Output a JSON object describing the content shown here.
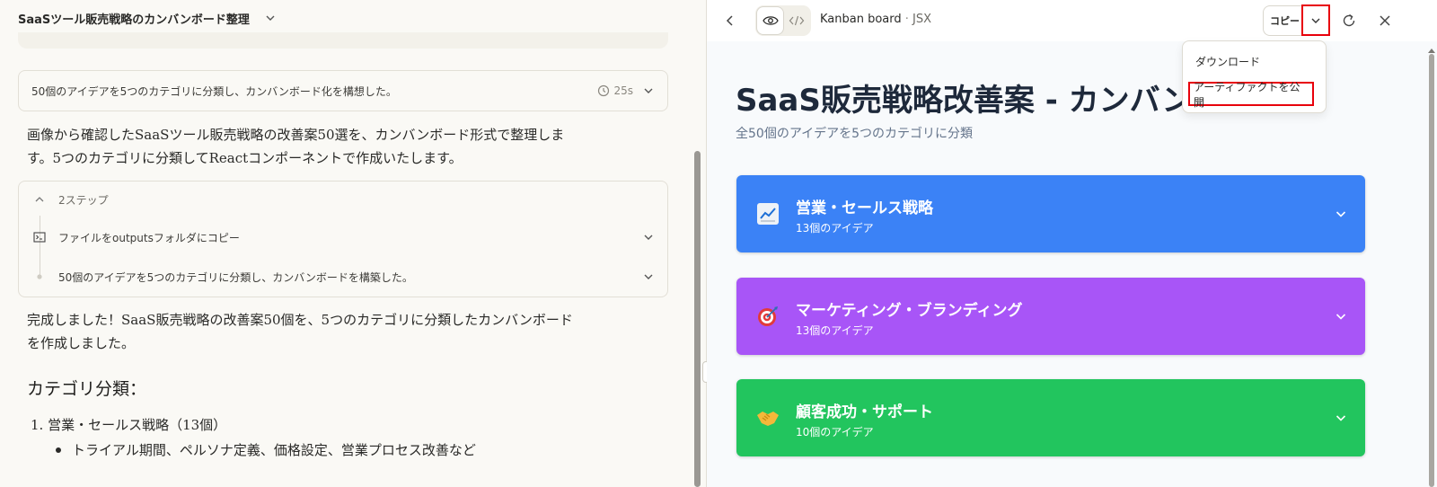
{
  "chat": {
    "title": "SaaSツール販売戦略のカンバンボード整理",
    "thinking_1": {
      "text": "50個のアイデアを5つのカテゴリに分類し、カンバンボード化を構想した。",
      "duration": "25s"
    },
    "intro_line1": "画像から確認したSaaSツール販売戦略の改善案50選を、カンバンボード形式で整理しま",
    "intro_line2": "す。5つのカテゴリに分類してReactコンポーネントで作成いたします。",
    "steps": {
      "summary": "2ステップ",
      "items": [
        {
          "label": "ファイルをoutputsフォルダにコピー",
          "icon": "terminal-icon"
        },
        {
          "label": "50個のアイデアを5つのカテゴリに分類し、カンバンボードを構築した。",
          "icon": "dot-icon"
        }
      ]
    },
    "done_line1": "完成しました！SaaS販売戦略の改善案50個を、5つのカテゴリに分類したカンバンボード",
    "done_line2": "を作成しました。",
    "category_heading": "カテゴリ分類：",
    "list_item_1": "1. 営業・セールス戦略（13個）",
    "list_item_1_bullet": "トライアル期間、ペルソナ定義、価格設定、営業プロセス改善など"
  },
  "artifact_toolbar": {
    "name": "Kanban board",
    "separator": " · ",
    "type": "JSX",
    "copy_label": "コピー"
  },
  "menu": {
    "download": "ダウンロード",
    "publish": "アーティファクトを公開"
  },
  "artifact": {
    "title": "SaaS販売戦略改善案 - カンバンボード",
    "subtitle": "全50個のアイデアを5つのカテゴリに分類",
    "categories": [
      {
        "name": "営業・セールス戦略",
        "count": "13個のアイデア",
        "color": "#3b82f6",
        "icon": "chart-icon"
      },
      {
        "name": "マーケティング・ブランディング",
        "count": "13個のアイデア",
        "color": "#a855f7",
        "icon": "target-icon"
      },
      {
        "name": "顧客成功・サポート",
        "count": "10個のアイデア",
        "color": "#22c55e",
        "icon": "handshake-icon"
      }
    ]
  },
  "colors": {
    "highlight": "#e8000b",
    "left_bg": "#faf9f5",
    "artifact_bg": "#f8fafc"
  }
}
